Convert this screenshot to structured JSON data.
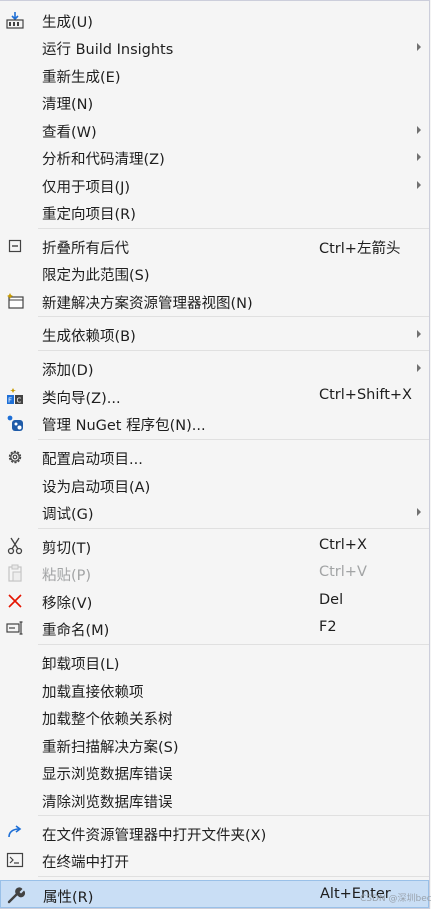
{
  "menu": {
    "items": [
      {
        "label": "生成(U)"
      },
      {
        "label": "运行 Build Insights"
      },
      {
        "label": "重新生成(E)"
      },
      {
        "label": "清理(N)"
      },
      {
        "label": "查看(W)"
      },
      {
        "label": "分析和代码清理(Z)"
      },
      {
        "label": "仅用于项目(J)"
      },
      {
        "label": "重定向项目(R)"
      },
      {
        "label": "折叠所有后代",
        "shortcut": "Ctrl+左箭头"
      },
      {
        "label": "限定为此范围(S)"
      },
      {
        "label": "新建解决方案资源管理器视图(N)"
      },
      {
        "label": "生成依赖项(B)"
      },
      {
        "label": "添加(D)"
      },
      {
        "label": "类向导(Z)...",
        "shortcut": "Ctrl+Shift+X"
      },
      {
        "label": "管理 NuGet 程序包(N)..."
      },
      {
        "label": "配置启动项目..."
      },
      {
        "label": "设为启动项目(A)"
      },
      {
        "label": "调试(G)"
      },
      {
        "label": "剪切(T)",
        "shortcut": "Ctrl+X"
      },
      {
        "label": "粘贴(P)",
        "shortcut": "Ctrl+V"
      },
      {
        "label": "移除(V)",
        "shortcut": "Del"
      },
      {
        "label": "重命名(M)",
        "shortcut": "F2"
      },
      {
        "label": "卸载项目(L)"
      },
      {
        "label": "加载直接依赖项"
      },
      {
        "label": "加载整个依赖关系树"
      },
      {
        "label": "重新扫描解决方案(S)"
      },
      {
        "label": "显示浏览数据库错误"
      },
      {
        "label": "清除浏览数据库错误"
      },
      {
        "label": "在文件资源管理器中打开文件夹(X)"
      },
      {
        "label": "在终端中打开"
      },
      {
        "label": "属性(R)",
        "shortcut": "Alt+Enter"
      }
    ]
  },
  "watermark": "CSDN @深圳beci",
  "colors": {
    "background": "#f5f5f5",
    "highlight": "#c9def5",
    "disabled": "#a2a4a5",
    "accent": "#1e6fd6",
    "danger": "#e51400"
  }
}
